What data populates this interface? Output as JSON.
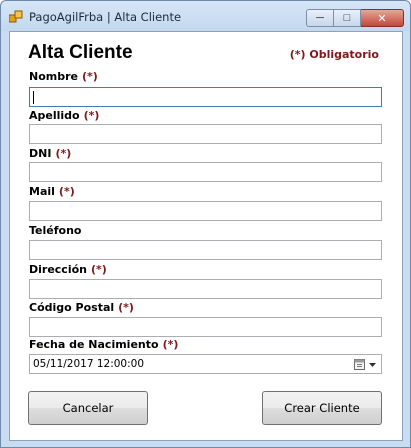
{
  "window": {
    "title": "PagoAgilFrba | Alta Cliente",
    "controls": {
      "minimize": "─",
      "maximize": "□",
      "close": "✕"
    }
  },
  "form": {
    "heading": "Alta Cliente",
    "required_note": "(*) Obligatorio",
    "required_marker": "(*)",
    "fields": [
      {
        "label": "Nombre",
        "required": true,
        "value": ""
      },
      {
        "label": "Apellido",
        "required": true,
        "value": ""
      },
      {
        "label": "DNI",
        "required": true,
        "value": ""
      },
      {
        "label": "Mail",
        "required": true,
        "value": ""
      },
      {
        "label": "Teléfono",
        "required": false,
        "value": ""
      },
      {
        "label": "Dirección",
        "required": true,
        "value": ""
      },
      {
        "label": "Código Postal",
        "required": true,
        "value": ""
      }
    ],
    "birthdate": {
      "label": "Fecha de Nacimiento",
      "required": true,
      "value": "05/11/2017 12:00:00"
    }
  },
  "buttons": {
    "cancel": "Cancelar",
    "create": "Crear Cliente"
  },
  "colors": {
    "required": "#7f1818",
    "titlebar": "#c9dcf0"
  }
}
